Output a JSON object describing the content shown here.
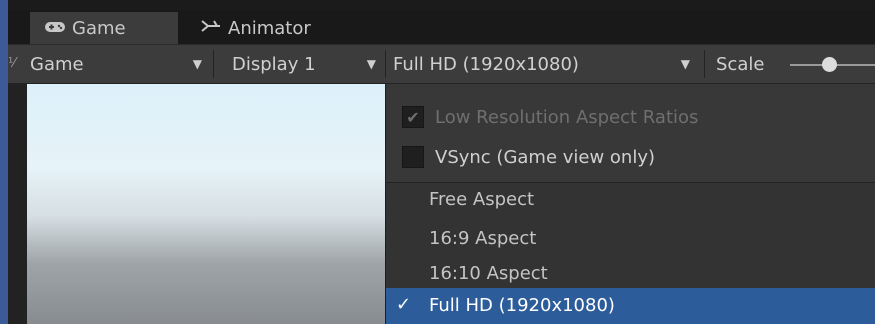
{
  "tabs": {
    "game_label": "Game",
    "animator_label": "Animator",
    "game_icon": "gamepad-icon",
    "animator_icon": "animator-icon"
  },
  "toolbar": {
    "view_dropdown": "Game",
    "display_dropdown": "Display 1",
    "resolution_dropdown": "Full HD (1920x1080)",
    "scale_label": "Scale"
  },
  "dropdown_menu": {
    "low_res_label": "Low Resolution Aspect Ratios",
    "low_res_checked": true,
    "vsync_label": "VSync (Game view only)",
    "vsync_checked": false,
    "options": [
      "Free Aspect",
      "16:9 Aspect",
      "16:10 Aspect"
    ],
    "selected_option": "Full HD (1920x1080)",
    "selected_mark": "✓"
  },
  "colors": {
    "selection": "#2c5c9a",
    "panel": "#3c3c3c",
    "menu": "#333333"
  }
}
